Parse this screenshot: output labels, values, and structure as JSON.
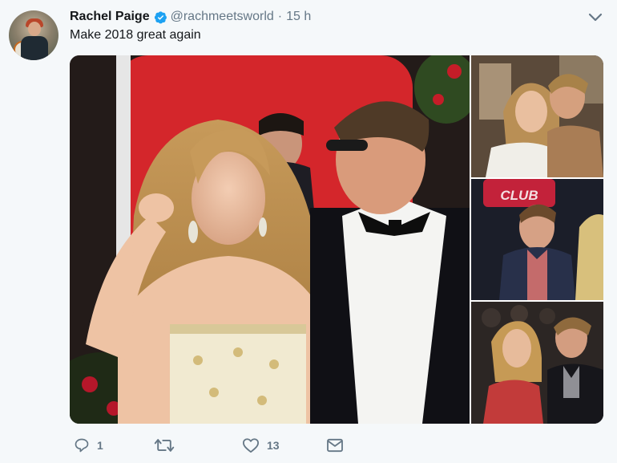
{
  "tweet": {
    "author_name": "Rachel Paige",
    "handle": "@rachmeetsworld",
    "separator": "·",
    "time": "15 h",
    "text": "Make 2018 great again"
  },
  "media": {
    "main_photo_icon": "couple-photo",
    "thumb_1_icon": "couple-photo",
    "thumb_2_icon": "man-photo",
    "thumb_2_sign": "CLUB",
    "thumb_3_icon": "couple-photo"
  },
  "actions": {
    "reply_count": "1",
    "retweet_count": "",
    "like_count": "13",
    "icons": [
      "reply-icon",
      "retweet-icon",
      "like-icon",
      "message-icon"
    ]
  },
  "colors": {
    "background": "#f5f8fa",
    "verified": "#1da1f2",
    "meta": "#657786",
    "text": "#14171a"
  }
}
